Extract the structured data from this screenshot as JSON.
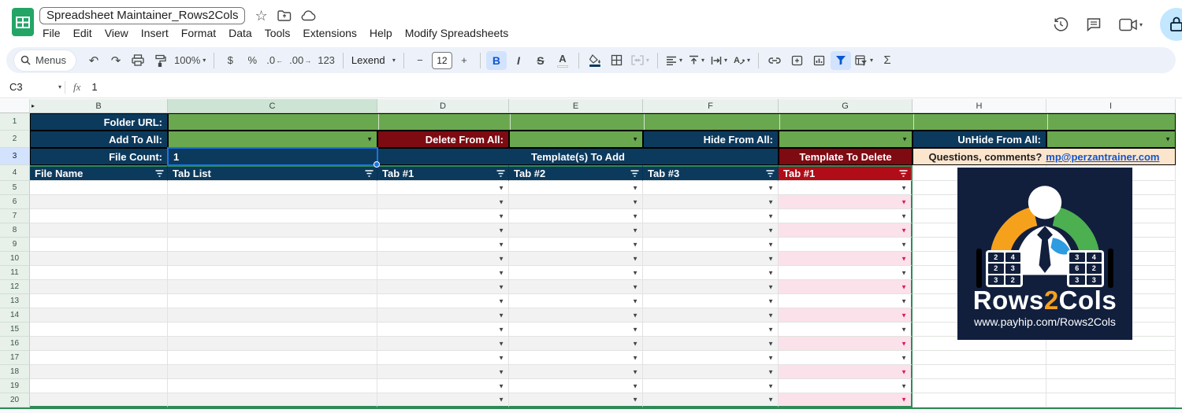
{
  "header": {
    "title": "Spreadsheet Maintainer_Rows2Cols",
    "menu": [
      "File",
      "Edit",
      "View",
      "Insert",
      "Format",
      "Data",
      "Tools",
      "Extensions",
      "Help",
      "Modify Spreadsheets"
    ]
  },
  "toolbar": {
    "menus": "Menus",
    "zoom": "100%",
    "currency": "$",
    "percent": "%",
    "decimal_decrease": ".0",
    "decimal_increase": ".00",
    "number_format": "123",
    "font": "Lexend",
    "font_size": "12",
    "minus": "−",
    "plus": "+",
    "bold": "B",
    "italic": "I",
    "strikethrough": "S",
    "text_color": "A",
    "sum": "Σ"
  },
  "formula_bar": {
    "cell_ref": "C3",
    "fx_label": "fx",
    "value": "1"
  },
  "sheet": {
    "col_headers": [
      "B",
      "C",
      "D",
      "E",
      "F",
      "G",
      "H",
      "I"
    ],
    "active_cell": "C3",
    "row1": {
      "num": "1",
      "label": "Folder URL:"
    },
    "row2": {
      "num": "2",
      "add": "Add To All:",
      "delete": "Delete From All:",
      "hide": "Hide From All:",
      "unhide": "UnHide From All:"
    },
    "row3": {
      "num": "3",
      "file_count_label": "File Count:",
      "file_count_value": "1",
      "template_add": "Template(s) To Add",
      "template_delete": "Template To Delete",
      "question": "Questions, comments?",
      "email": "mp@perzantrainer.com"
    },
    "row4": {
      "num": "4",
      "b": "File Name",
      "c": "Tab List",
      "d": "Tab #1",
      "e": "Tab #2",
      "f": "Tab #3",
      "g": "Tab #1"
    },
    "data_row_numbers": [
      5,
      6,
      7,
      8,
      9,
      10,
      11,
      12,
      13,
      14,
      15,
      16,
      17,
      18,
      19,
      20
    ]
  },
  "logo": {
    "wordmark_pre": "Rows",
    "wordmark_num": "2",
    "wordmark_post": "Cols",
    "url": "www.payhip.com/Rows2Cols",
    "calc_left": [
      "2",
      "4",
      "2",
      "3",
      "3",
      "2"
    ],
    "calc_right": [
      "3",
      "4",
      "6",
      "2",
      "3",
      "3"
    ]
  },
  "colors": {
    "navy": "#0c3a5d",
    "green": "#6aa84f",
    "maroon": "#7e0a12",
    "red": "#b00d19",
    "pink": "#fbe1ea",
    "pink-arrow": "#d81b60",
    "peach": "#fce5cd",
    "link": "#1155cc",
    "selection": "#1a73e8",
    "range-border": "#2e8b57",
    "logo-bg": "#111f3d",
    "logo-orange": "#f6a11c",
    "logo-green": "#4caf50",
    "logo-blue": "#2f9be0",
    "logo-red": "#e04420"
  }
}
